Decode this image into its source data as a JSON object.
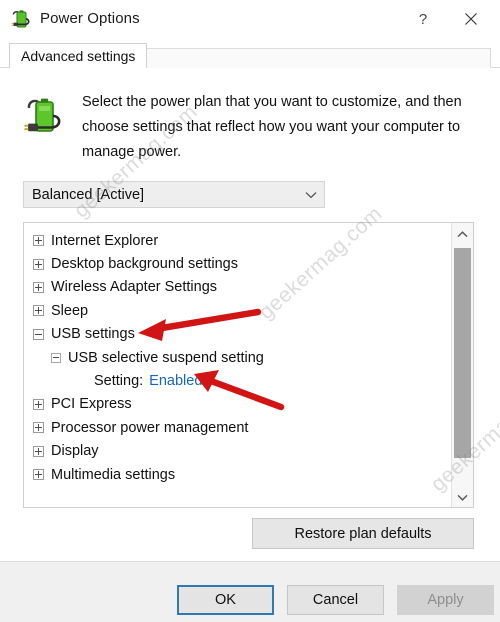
{
  "window": {
    "title": "Power Options",
    "icon": "power-plan-battery-icon",
    "help_label": "?",
    "close_label": "×"
  },
  "tabs": [
    {
      "label": "Advanced settings",
      "active": true
    }
  ],
  "description": {
    "icon": "battery-plug-icon",
    "text": "Select the power plan that you want to customize, and then choose settings that reflect how you want your computer to manage power."
  },
  "plan_select": {
    "value": "Balanced [Active]",
    "arrow_icon": "chevron-down-icon"
  },
  "tree": {
    "rows": [
      {
        "label": "Internet Explorer",
        "level": 0,
        "state": "collapsed"
      },
      {
        "label": "Desktop background settings",
        "level": 0,
        "state": "collapsed"
      },
      {
        "label": "Wireless Adapter Settings",
        "level": 0,
        "state": "collapsed"
      },
      {
        "label": "Sleep",
        "level": 0,
        "state": "collapsed"
      },
      {
        "label": "USB settings",
        "level": 0,
        "state": "expanded"
      },
      {
        "label": "USB selective suspend setting",
        "level": 1,
        "state": "expanded"
      },
      {
        "label": "Setting:",
        "value": "Enabled",
        "level": 2,
        "state": "leaf"
      },
      {
        "label": "PCI Express",
        "level": 0,
        "state": "collapsed"
      },
      {
        "label": "Processor power management",
        "level": 0,
        "state": "collapsed"
      },
      {
        "label": "Display",
        "level": 0,
        "state": "collapsed"
      },
      {
        "label": "Multimedia settings",
        "level": 0,
        "state": "collapsed"
      }
    ]
  },
  "scrollbar": {
    "up_icon": "chevron-up-icon",
    "down_icon": "chevron-down-icon"
  },
  "restore": {
    "label": "Restore plan defaults"
  },
  "footer": {
    "ok": "OK",
    "cancel": "Cancel",
    "apply": "Apply"
  },
  "annotations": {
    "arrow_color": "#d11515",
    "arrows": [
      {
        "name": "arrow-usb-settings",
        "points_to": "USB settings"
      },
      {
        "name": "arrow-enabled-link",
        "points_to": "Enabled"
      }
    ]
  },
  "watermark": {
    "text": "geekermag.com",
    "color": "#787878"
  }
}
